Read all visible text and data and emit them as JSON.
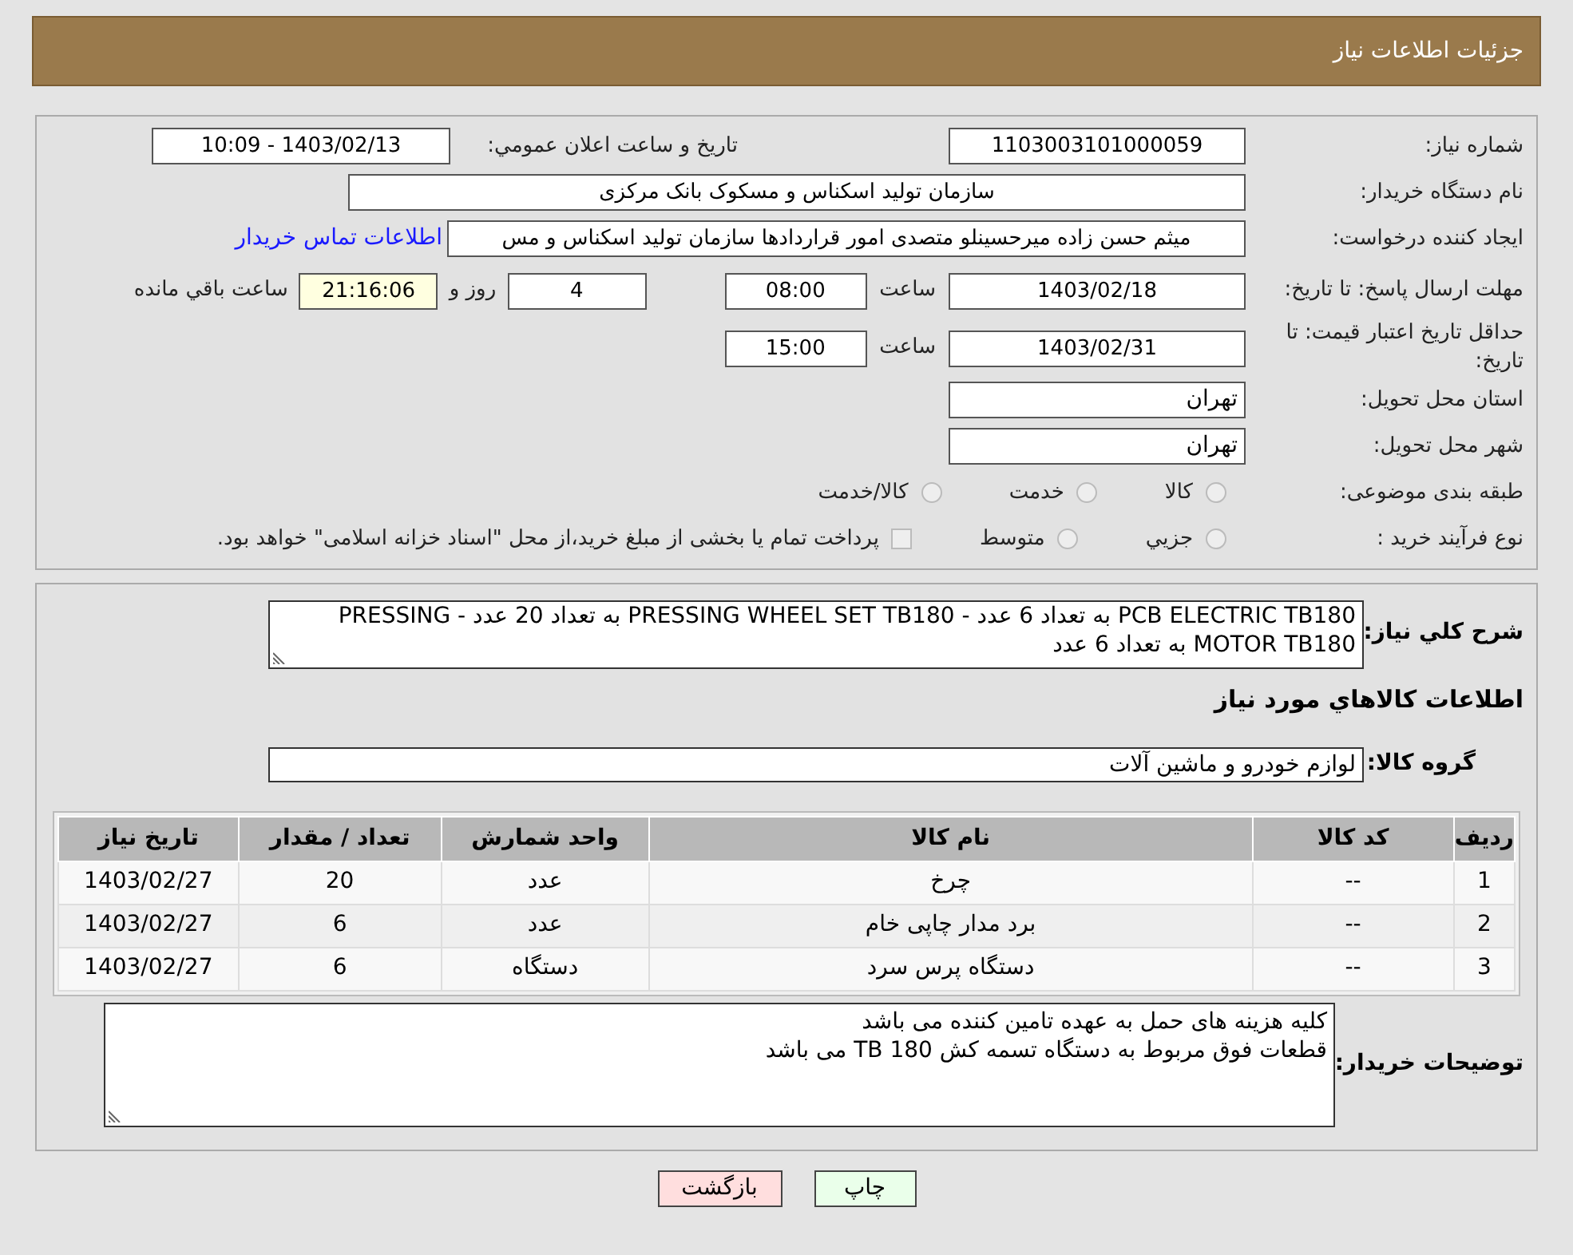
{
  "header": {
    "title": "جزئیات اطلاعات نیاز"
  },
  "fields": {
    "need_number": {
      "label": "شماره نیاز:",
      "value": "1103003101000059"
    },
    "announce": {
      "label": "تاريخ و ساعت اعلان عمومي:",
      "value": "1403/02/13 - 10:09"
    },
    "buyer_org": {
      "label": "نام دستگاه خریدار:",
      "value": "سازمان تولید اسکناس و مسکوک بانک مرکزی"
    },
    "requester": {
      "label": "ایجاد کننده درخواست:",
      "value": "میثم حسن زاده میرحسینلو متصدی امور قراردادها سازمان تولید اسکناس و مس",
      "link": "اطلاعات تماس خریدار"
    },
    "deadline": {
      "label": "مهلت ارسال پاسخ: تا تاریخ:",
      "date": "1403/02/18",
      "time_label": "ساعت",
      "time": "08:00",
      "days": "4",
      "days_label": "روز و",
      "remaining": "21:16:06",
      "remaining_label": "ساعت باقي مانده"
    },
    "validity": {
      "label": "حداقل تاریخ اعتبار قیمت: تا تاریخ:",
      "date": "1403/02/31",
      "time_label": "ساعت",
      "time": "15:00"
    },
    "province": {
      "label": "استان محل تحویل:",
      "value": "تهران"
    },
    "city": {
      "label": "شهر محل تحویل:",
      "value": "تهران"
    },
    "category": {
      "label": "طبقه بندی موضوعی:",
      "options": [
        {
          "label": "كالا",
          "selected": false
        },
        {
          "label": "خدمت",
          "selected": false
        },
        {
          "label": "كالا/خدمت",
          "selected": false
        }
      ]
    },
    "process": {
      "label": "نوع فرآیند خرید :",
      "options": [
        {
          "label": "جزيي",
          "selected": false
        },
        {
          "label": "متوسط",
          "selected": false
        }
      ],
      "note": "پرداخت تمام یا بخشی از مبلغ خرید،از محل \"اسناد خزانه اسلامی\" خواهد بود.",
      "note_checked": false
    }
  },
  "summary": {
    "label": "شرح کلي نیاز:",
    "value": "PCB ELECTRIC TB180 به تعداد 6 عدد - PRESSING WHEEL SET TB180  به تعداد 20 عدد - PRESSING MOTOR TB180 به تعداد 6 عدد"
  },
  "goods_heading": "اطلاعات کالاهاي مورد نیاز",
  "goods_group": {
    "label": "گروه کالا:",
    "value": "لوازم خودرو و ماشین آلات"
  },
  "table": {
    "columns": [
      "ردیف",
      "کد کالا",
      "نام کالا",
      "واحد شمارش",
      "تعداد / مقدار",
      "تاریخ نیاز"
    ],
    "rows": [
      [
        "1",
        "--",
        "چرخ",
        "عدد",
        "20",
        "1403/02/27"
      ],
      [
        "2",
        "--",
        "برد مدار چاپی خام",
        "عدد",
        "6",
        "1403/02/27"
      ],
      [
        "3",
        "--",
        "دستگاه پرس سرد",
        "دستگاه",
        "6",
        "1403/02/27"
      ]
    ]
  },
  "buyer_notes": {
    "label": "توضیحات خریدار:",
    "lines": [
      "کلیه هزینه های حمل به عهده تامین کننده می باشد",
      "قطعات فوق مربوط به دستگاه تسمه کش TB 180 می باشد"
    ]
  },
  "buttons": [
    {
      "label": "چاپ",
      "kind": "print"
    },
    {
      "label": "بازگشت",
      "kind": "back"
    }
  ]
}
